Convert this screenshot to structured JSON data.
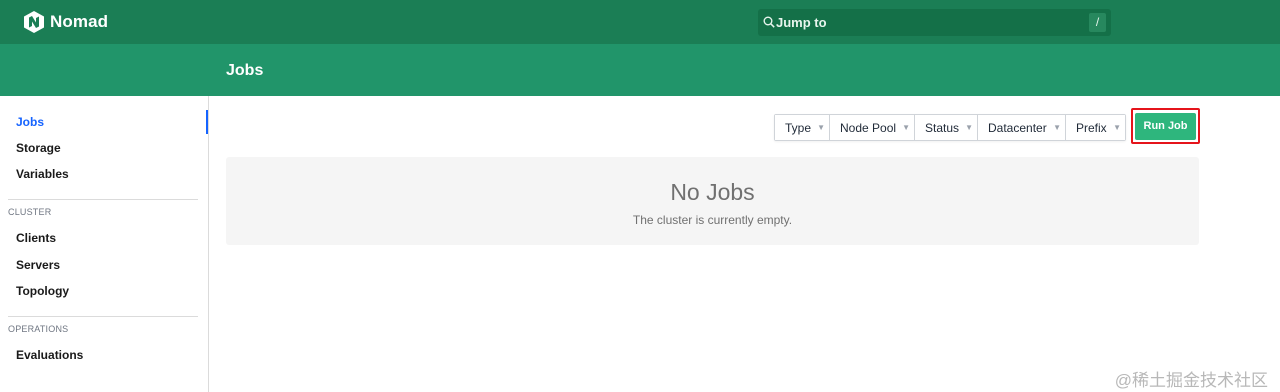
{
  "app": {
    "name": "Nomad",
    "brand_color": "#1b7e55",
    "subnav_color": "#21956a",
    "accent": "#2eb67d"
  },
  "search": {
    "placeholder": "Jump to",
    "shortcut": "/",
    "icon": "search-icon"
  },
  "page": {
    "title": "Jobs"
  },
  "sidebar": {
    "items": [
      {
        "label": "Jobs",
        "active": true
      },
      {
        "label": "Storage"
      },
      {
        "label": "Variables"
      }
    ],
    "cluster_heading": "CLUSTER",
    "cluster_items": [
      {
        "label": "Clients"
      },
      {
        "label": "Servers"
      },
      {
        "label": "Topology"
      }
    ],
    "operations_heading": "OPERATIONS",
    "operations_items": [
      {
        "label": "Evaluations"
      }
    ]
  },
  "filters": [
    {
      "label": "Type"
    },
    {
      "label": "Node Pool"
    },
    {
      "label": "Status"
    },
    {
      "label": "Datacenter"
    },
    {
      "label": "Prefix"
    }
  ],
  "actions": {
    "run_job": "Run Job"
  },
  "empty_state": {
    "title": "No Jobs",
    "message": "The cluster is currently empty."
  },
  "watermark": "@稀土掘金技术社区"
}
